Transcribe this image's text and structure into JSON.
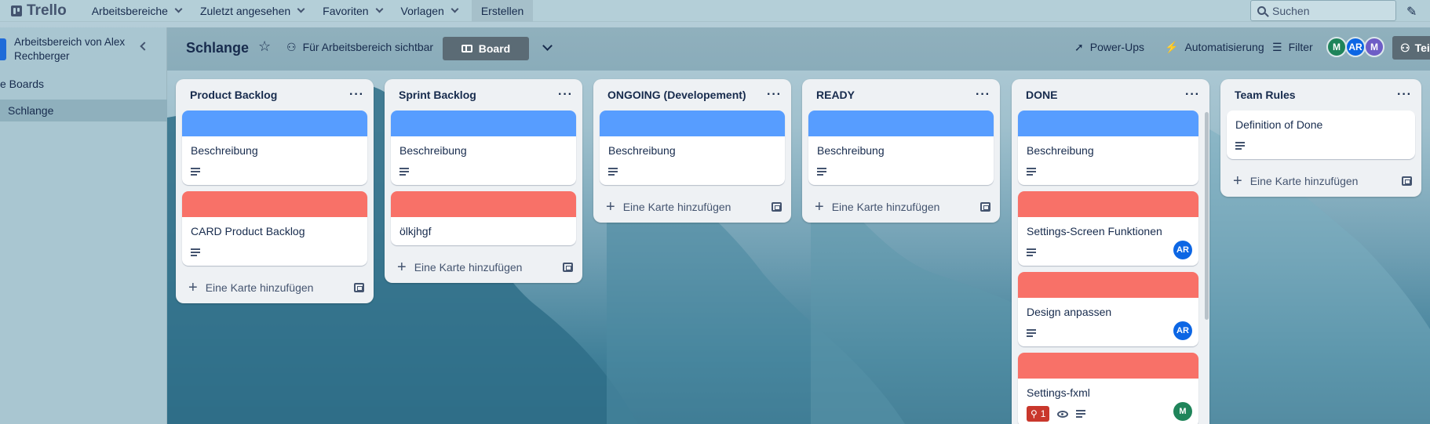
{
  "topnav": {
    "logo": "Trello",
    "items": [
      "Arbeitsbereiche",
      "Zuletzt angesehen",
      "Favoriten",
      "Vorlagen"
    ],
    "create": "Erstellen",
    "search_placeholder": "Suchen"
  },
  "sidebar": {
    "workspace": "Arbeitsbereich von Alex Rechberger",
    "boards_label": "e Boards",
    "active_board": "Schlange"
  },
  "board": {
    "title": "Schlange",
    "visibility": "Für Arbeitsbereich sichtbar",
    "view": "Board",
    "powerups": "Power-Ups",
    "automation": "Automatisierung",
    "filter": "Filter",
    "share": "Teile",
    "members": [
      {
        "initials": "M",
        "color": "#1f845a"
      },
      {
        "initials": "AR",
        "color": "#0c66e4"
      },
      {
        "initials": "M",
        "color": "#6e5dc6"
      }
    ]
  },
  "colors": {
    "blue_cover": "#579dff",
    "red_cover": "#f87168"
  },
  "add_card_label": "Eine Karte hinzufügen",
  "lists": [
    {
      "title": "Product Backlog",
      "cards": [
        {
          "cover": "blue",
          "title": "Beschreibung"
        },
        {
          "cover": "red",
          "title": "CARD Product Backlog"
        }
      ]
    },
    {
      "title": "Sprint Backlog",
      "cards": [
        {
          "cover": "blue",
          "title": "Beschreibung"
        },
        {
          "cover": "red",
          "title": "ölkjhgf"
        }
      ]
    },
    {
      "title": "ONGOING (Developement)",
      "cards": [
        {
          "cover": "blue",
          "title": "Beschreibung"
        }
      ]
    },
    {
      "title": "READY",
      "cards": [
        {
          "cover": "blue",
          "title": "Beschreibung"
        }
      ]
    },
    {
      "title": "DONE",
      "cards": [
        {
          "cover": "blue",
          "title": "Beschreibung"
        },
        {
          "cover": "red",
          "title": "Settings-Screen Funktionen",
          "member": "AR"
        },
        {
          "cover": "red",
          "title": "Design anpassen",
          "member": "AR"
        },
        {
          "cover": "red",
          "title": "Settings-fxml",
          "member": "M",
          "votes": "1"
        }
      ]
    },
    {
      "title": "Team Rules",
      "cards": [
        {
          "title": "Definition of Done"
        }
      ]
    }
  ]
}
